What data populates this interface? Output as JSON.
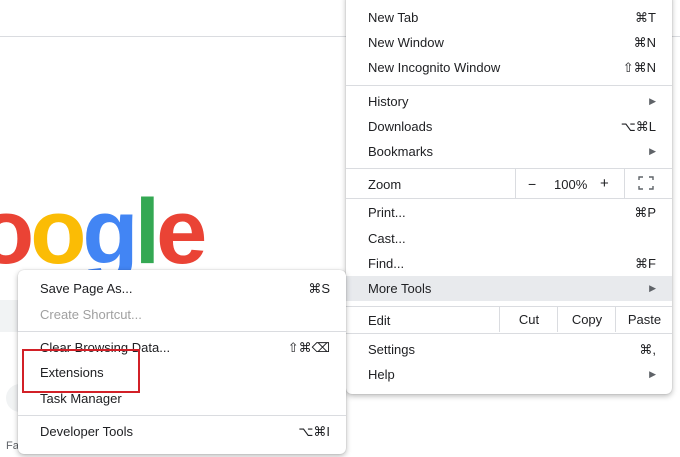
{
  "background": {
    "logo_letters": [
      "o",
      "o",
      "g",
      "l",
      "e"
    ],
    "logo_colors": [
      "#EA4335",
      "#FBBC05",
      "#4285F4",
      "#34A853",
      "#EA4335"
    ],
    "footer_text": "Fa"
  },
  "main_menu": {
    "new_tab": {
      "label": "New Tab",
      "shortcut": "⌘T"
    },
    "new_window": {
      "label": "New Window",
      "shortcut": "⌘N"
    },
    "new_incognito": {
      "label": "New Incognito Window",
      "shortcut": "⇧⌘N"
    },
    "history": {
      "label": "History"
    },
    "downloads": {
      "label": "Downloads",
      "shortcut": "⌥⌘L"
    },
    "bookmarks": {
      "label": "Bookmarks"
    },
    "zoom": {
      "label": "Zoom",
      "minus": "−",
      "value": "100%",
      "plus": "+"
    },
    "print": {
      "label": "Print...",
      "shortcut": "⌘P"
    },
    "cast": {
      "label": "Cast..."
    },
    "find": {
      "label": "Find...",
      "shortcut": "⌘F"
    },
    "more_tools": {
      "label": "More Tools"
    },
    "edit": {
      "label": "Edit",
      "cut": "Cut",
      "copy": "Copy",
      "paste": "Paste"
    },
    "settings": {
      "label": "Settings",
      "shortcut": "⌘,"
    },
    "help": {
      "label": "Help"
    }
  },
  "sub_menu": {
    "save_page": {
      "label": "Save Page As...",
      "shortcut": "⌘S"
    },
    "create_shortcut": {
      "label": "Create Shortcut..."
    },
    "clear_browsing": {
      "label": "Clear Browsing Data...",
      "shortcut": "⇧⌘⌫"
    },
    "extensions": {
      "label": "Extensions"
    },
    "task_manager": {
      "label": "Task Manager"
    },
    "developer_tools": {
      "label": "Developer Tools",
      "shortcut": "⌥⌘I"
    }
  },
  "colors": {
    "highlight_border": "#D22027",
    "hover_bg": "#E8EAED"
  }
}
